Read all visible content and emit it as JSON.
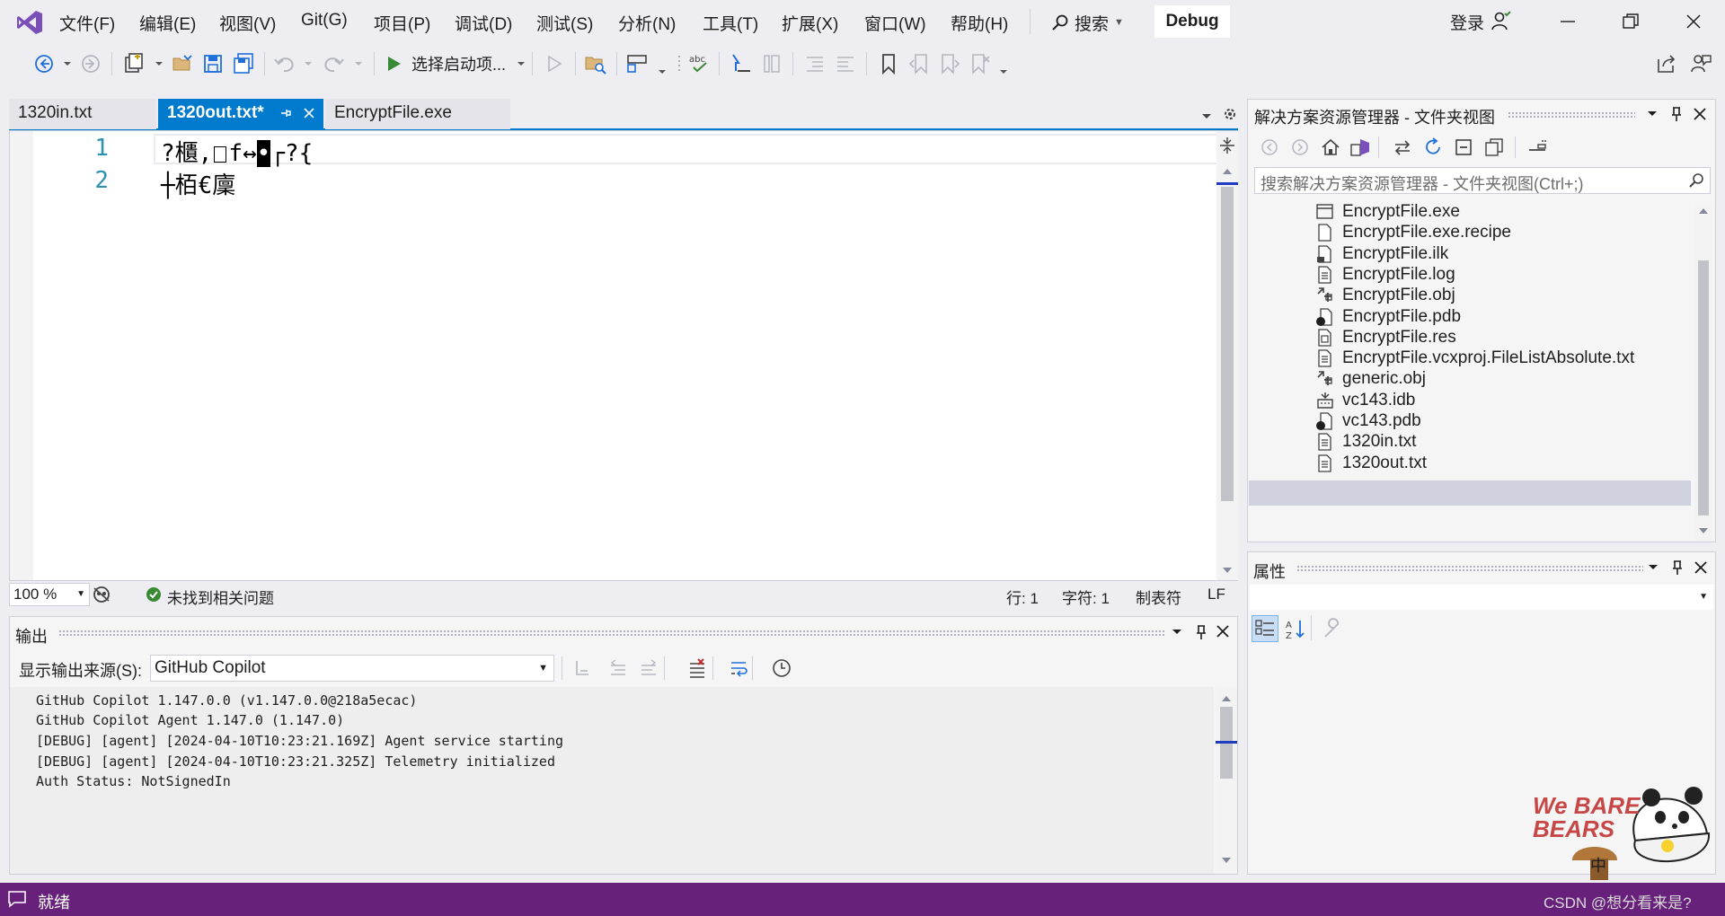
{
  "menu": [
    "文件(F)",
    "编辑(E)",
    "视图(V)",
    "Git(G)",
    "项目(P)",
    "调试(D)",
    "测试(S)",
    "分析(N)",
    "工具(T)",
    "扩展(X)",
    "窗口(W)",
    "帮助(H)"
  ],
  "search_label": "搜索",
  "config_badge": "Debug",
  "login_label": "登录",
  "toolbar": {
    "start_label": "选择启动项..."
  },
  "tabs": [
    {
      "label": "1320in.txt",
      "active": false
    },
    {
      "label": "1320out.txt*",
      "active": true
    },
    {
      "label": "EncryptFile.exe",
      "active": false
    }
  ],
  "editor": {
    "lines": [
      {
        "num": "1",
        "text_a": "?櫃,",
        "text_b": "f↔",
        "cursor_char": "•",
        "text_c": "┌?{"
      },
      {
        "num": "2",
        "text_a": "┼栢€廩",
        "text_b": "",
        "cursor_char": "",
        "text_c": ""
      }
    ],
    "zoom": "100 %",
    "issues": "未找到相关问题",
    "status_line": "行: 1",
    "status_char": "字符: 1",
    "status_tab": "制表符",
    "status_eol": "LF"
  },
  "output": {
    "title": "输出",
    "source_label": "显示输出来源(S):",
    "source_value": "GitHub Copilot",
    "lines": [
      "GitHub Copilot 1.147.0.0 (v1.147.0.0@218a5ecac)",
      "GitHub Copilot Agent 1.147.0 (1.147.0)",
      "[DEBUG] [agent] [2024-04-10T10:23:21.169Z] Agent service starting",
      "[DEBUG] [agent] [2024-04-10T10:23:21.325Z] Telemetry initialized",
      "Auth Status: NotSignedIn"
    ]
  },
  "solution": {
    "title": "解决方案资源管理器 - 文件夹视图",
    "search_placeholder": "搜索解决方案资源管理器 - 文件夹视图(Ctrl+;)",
    "files": [
      {
        "name": "EncryptFile.exe",
        "icon": "exe-icon",
        "selected": false
      },
      {
        "name": "EncryptFile.exe.recipe",
        "icon": "file-icon",
        "selected": false
      },
      {
        "name": "EncryptFile.ilk",
        "icon": "binary-file-icon",
        "selected": false
      },
      {
        "name": "EncryptFile.log",
        "icon": "text-file-icon",
        "selected": false
      },
      {
        "name": "EncryptFile.obj",
        "icon": "obj-file-icon",
        "selected": false
      },
      {
        "name": "EncryptFile.pdb",
        "icon": "pdb-file-icon",
        "selected": false
      },
      {
        "name": "EncryptFile.res",
        "icon": "resource-file-icon",
        "selected": false
      },
      {
        "name": "EncryptFile.vcxproj.FileListAbsolute.txt",
        "icon": "text-file-icon",
        "selected": false
      },
      {
        "name": "generic.obj",
        "icon": "obj-file-icon",
        "selected": false
      },
      {
        "name": "vc143.idb",
        "icon": "idb-file-icon",
        "selected": false
      },
      {
        "name": "vc143.pdb",
        "icon": "pdb-file-icon",
        "selected": false
      },
      {
        "name": "1320in.txt",
        "icon": "text-file-icon",
        "selected": true
      },
      {
        "name": "1320out.txt",
        "icon": "text-file-icon",
        "selected": false
      }
    ]
  },
  "properties": {
    "title": "属性"
  },
  "statusbar": {
    "ready": "就绪"
  },
  "watermark": {
    "text": "CSDN @想分看来是?",
    "logo_text": "We BARE BEARS",
    "ime_text": "中"
  },
  "colors": {
    "accent": "#68217a",
    "tab_active": "#007acc",
    "selection": "#cfd1de",
    "linenum": "#2b91af"
  }
}
